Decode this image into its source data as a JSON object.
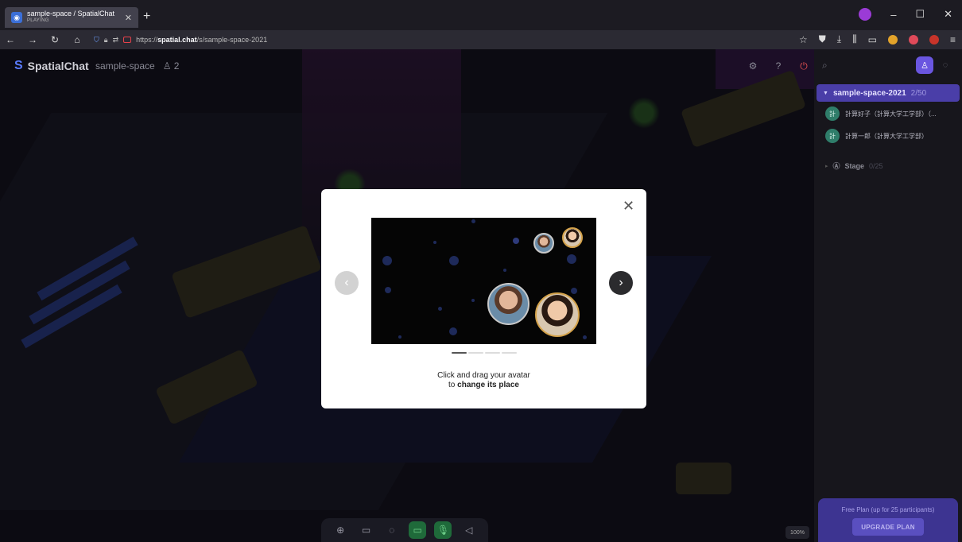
{
  "browser": {
    "tab_title": "sample-space / SpatialChat",
    "tab_status": "PLAYING",
    "url_prefix": "https://",
    "url_host": "spatial.chat",
    "url_path": "/s/sample-space-2021"
  },
  "app": {
    "brand": "SpatialChat",
    "space_name": "sample-space",
    "people_count": "2",
    "zoom_label": "100%"
  },
  "sidebar": {
    "room": {
      "name": "sample-space-2021",
      "count": "2/50"
    },
    "participants": [
      {
        "initial": "計",
        "name": "計算好子（計算大学工学部）（..."
      },
      {
        "initial": "計",
        "name": "計算一郎（計算大学工学部）"
      }
    ],
    "stage": {
      "name": "Stage",
      "count": "0/25"
    },
    "plan_text": "Free Plan (up for 25 participants)",
    "upgrade_label": "UPGRADE PLAN"
  },
  "modal": {
    "caption_line1": "Click and drag your avatar",
    "caption_line2_prefix": "to ",
    "caption_line2_bold": "change its place",
    "active_page": 1,
    "total_pages": 4
  },
  "icons": {
    "close": "close-icon",
    "prev": "chevron-left-icon",
    "next": "chevron-right-icon"
  },
  "colors": {
    "accent": "#6a56e0",
    "room_header": "#4a3ea8",
    "mic_active": "#1f6a3a",
    "power": "#e05050"
  }
}
